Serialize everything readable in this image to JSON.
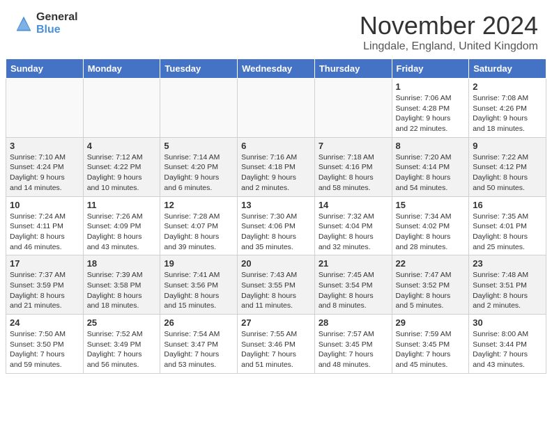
{
  "logo": {
    "general": "General",
    "blue": "Blue"
  },
  "header": {
    "month": "November 2024",
    "location": "Lingdale, England, United Kingdom"
  },
  "weekdays": [
    "Sunday",
    "Monday",
    "Tuesday",
    "Wednesday",
    "Thursday",
    "Friday",
    "Saturday"
  ],
  "weeks": [
    [
      {
        "day": "",
        "info": ""
      },
      {
        "day": "",
        "info": ""
      },
      {
        "day": "",
        "info": ""
      },
      {
        "day": "",
        "info": ""
      },
      {
        "day": "",
        "info": ""
      },
      {
        "day": "1",
        "info": "Sunrise: 7:06 AM\nSunset: 4:28 PM\nDaylight: 9 hours\nand 22 minutes."
      },
      {
        "day": "2",
        "info": "Sunrise: 7:08 AM\nSunset: 4:26 PM\nDaylight: 9 hours\nand 18 minutes."
      }
    ],
    [
      {
        "day": "3",
        "info": "Sunrise: 7:10 AM\nSunset: 4:24 PM\nDaylight: 9 hours\nand 14 minutes."
      },
      {
        "day": "4",
        "info": "Sunrise: 7:12 AM\nSunset: 4:22 PM\nDaylight: 9 hours\nand 10 minutes."
      },
      {
        "day": "5",
        "info": "Sunrise: 7:14 AM\nSunset: 4:20 PM\nDaylight: 9 hours\nand 6 minutes."
      },
      {
        "day": "6",
        "info": "Sunrise: 7:16 AM\nSunset: 4:18 PM\nDaylight: 9 hours\nand 2 minutes."
      },
      {
        "day": "7",
        "info": "Sunrise: 7:18 AM\nSunset: 4:16 PM\nDaylight: 8 hours\nand 58 minutes."
      },
      {
        "day": "8",
        "info": "Sunrise: 7:20 AM\nSunset: 4:14 PM\nDaylight: 8 hours\nand 54 minutes."
      },
      {
        "day": "9",
        "info": "Sunrise: 7:22 AM\nSunset: 4:12 PM\nDaylight: 8 hours\nand 50 minutes."
      }
    ],
    [
      {
        "day": "10",
        "info": "Sunrise: 7:24 AM\nSunset: 4:11 PM\nDaylight: 8 hours\nand 46 minutes."
      },
      {
        "day": "11",
        "info": "Sunrise: 7:26 AM\nSunset: 4:09 PM\nDaylight: 8 hours\nand 43 minutes."
      },
      {
        "day": "12",
        "info": "Sunrise: 7:28 AM\nSunset: 4:07 PM\nDaylight: 8 hours\nand 39 minutes."
      },
      {
        "day": "13",
        "info": "Sunrise: 7:30 AM\nSunset: 4:06 PM\nDaylight: 8 hours\nand 35 minutes."
      },
      {
        "day": "14",
        "info": "Sunrise: 7:32 AM\nSunset: 4:04 PM\nDaylight: 8 hours\nand 32 minutes."
      },
      {
        "day": "15",
        "info": "Sunrise: 7:34 AM\nSunset: 4:02 PM\nDaylight: 8 hours\nand 28 minutes."
      },
      {
        "day": "16",
        "info": "Sunrise: 7:35 AM\nSunset: 4:01 PM\nDaylight: 8 hours\nand 25 minutes."
      }
    ],
    [
      {
        "day": "17",
        "info": "Sunrise: 7:37 AM\nSunset: 3:59 PM\nDaylight: 8 hours\nand 21 minutes."
      },
      {
        "day": "18",
        "info": "Sunrise: 7:39 AM\nSunset: 3:58 PM\nDaylight: 8 hours\nand 18 minutes."
      },
      {
        "day": "19",
        "info": "Sunrise: 7:41 AM\nSunset: 3:56 PM\nDaylight: 8 hours\nand 15 minutes."
      },
      {
        "day": "20",
        "info": "Sunrise: 7:43 AM\nSunset: 3:55 PM\nDaylight: 8 hours\nand 11 minutes."
      },
      {
        "day": "21",
        "info": "Sunrise: 7:45 AM\nSunset: 3:54 PM\nDaylight: 8 hours\nand 8 minutes."
      },
      {
        "day": "22",
        "info": "Sunrise: 7:47 AM\nSunset: 3:52 PM\nDaylight: 8 hours\nand 5 minutes."
      },
      {
        "day": "23",
        "info": "Sunrise: 7:48 AM\nSunset: 3:51 PM\nDaylight: 8 hours\nand 2 minutes."
      }
    ],
    [
      {
        "day": "24",
        "info": "Sunrise: 7:50 AM\nSunset: 3:50 PM\nDaylight: 7 hours\nand 59 minutes."
      },
      {
        "day": "25",
        "info": "Sunrise: 7:52 AM\nSunset: 3:49 PM\nDaylight: 7 hours\nand 56 minutes."
      },
      {
        "day": "26",
        "info": "Sunrise: 7:54 AM\nSunset: 3:47 PM\nDaylight: 7 hours\nand 53 minutes."
      },
      {
        "day": "27",
        "info": "Sunrise: 7:55 AM\nSunset: 3:46 PM\nDaylight: 7 hours\nand 51 minutes."
      },
      {
        "day": "28",
        "info": "Sunrise: 7:57 AM\nSunset: 3:45 PM\nDaylight: 7 hours\nand 48 minutes."
      },
      {
        "day": "29",
        "info": "Sunrise: 7:59 AM\nSunset: 3:45 PM\nDaylight: 7 hours\nand 45 minutes."
      },
      {
        "day": "30",
        "info": "Sunrise: 8:00 AM\nSunset: 3:44 PM\nDaylight: 7 hours\nand 43 minutes."
      }
    ]
  ]
}
